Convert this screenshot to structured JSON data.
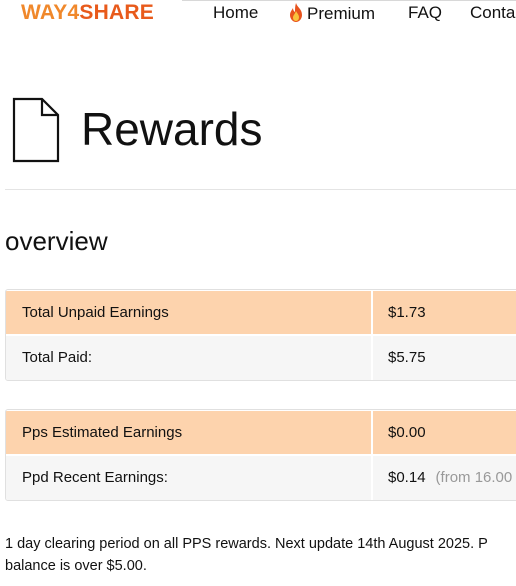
{
  "header": {
    "logo": {
      "part1": "WAY4",
      "part2": "SHARE"
    },
    "nav": [
      {
        "label": "Home"
      },
      {
        "label": "Premium",
        "icon": "flame-icon"
      },
      {
        "label": "FAQ"
      },
      {
        "label": "Conta"
      }
    ]
  },
  "page": {
    "icon": "document-icon",
    "title": "Rewards"
  },
  "overview": {
    "title": "overview",
    "earnings": [
      {
        "label": "Total Unpaid Earnings",
        "value": "$1.73"
      },
      {
        "label": "Total Paid:",
        "value": "$5.75"
      }
    ],
    "estimates": [
      {
        "label": "Pps Estimated Earnings",
        "value": "$0.00"
      },
      {
        "label": "Ppd Recent Earnings:",
        "value": "$0.14",
        "note": "(from 16.00"
      }
    ]
  },
  "footnote": {
    "line1": "1 day clearing period on all PPS rewards. Next update 14th August 2025.  P",
    "line2": "balance is over $5.00."
  },
  "colors": {
    "highlight_row": "#fdd3ad",
    "plain_row": "#f6f6f6",
    "logo_orange": "#f0882b",
    "logo_red": "#e85a1b"
  }
}
